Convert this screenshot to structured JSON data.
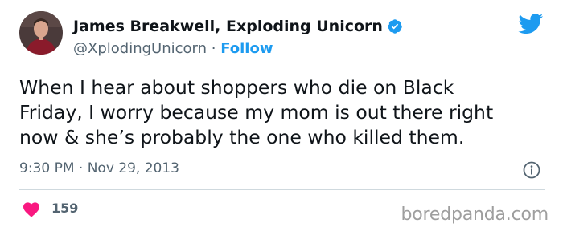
{
  "author": {
    "display_name": "James Breakwell, Exploding Unicorn",
    "handle": "@XplodingUnicorn",
    "separator": " · ",
    "follow_label": "Follow"
  },
  "tweet": {
    "text": "When I hear about shoppers who die on Black\nFriday, I worry because my mom is out there right\nnow & she’s probably the one who killed them.",
    "timestamp": "9:30 PM · Nov 29, 2013"
  },
  "engagement": {
    "likes": "159"
  },
  "watermark": "boredpanda.com",
  "colors": {
    "accent": "#1d9bf0",
    "heart": "#f91880",
    "muted": "#536471"
  },
  "icons": {
    "verified": "verified-badge-icon",
    "platform": "twitter-bird-icon",
    "info": "info-icon",
    "like": "heart-icon"
  }
}
